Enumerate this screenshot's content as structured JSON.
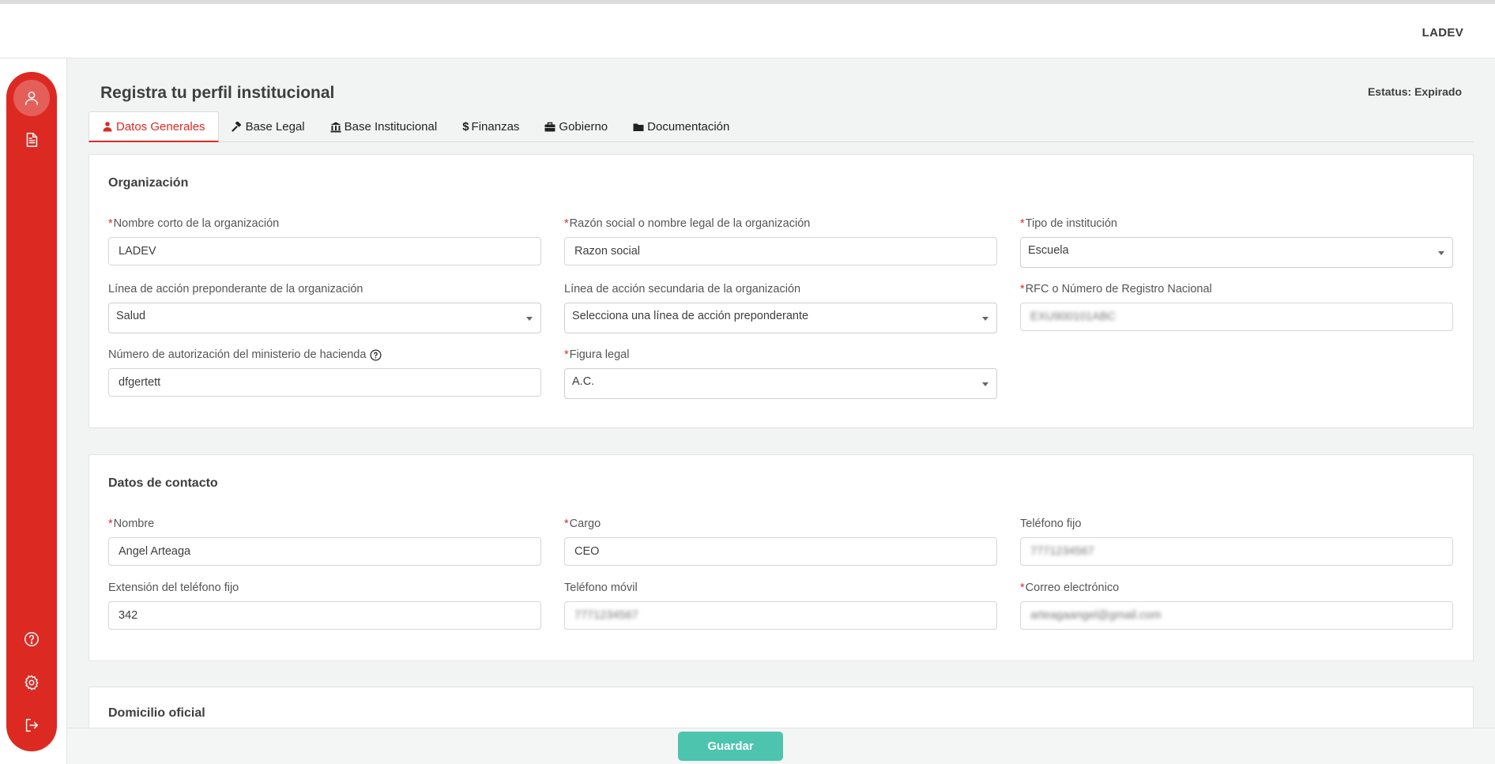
{
  "header": {
    "user": "LADEV"
  },
  "page": {
    "title": "Registra tu perfil institucional",
    "status": "Estatus: Expirado"
  },
  "tabs": [
    {
      "label": "Datos Generales",
      "icon": "user-icon"
    },
    {
      "label": "Base Legal",
      "icon": "gavel-icon"
    },
    {
      "label": "Base Institucional",
      "icon": "institution-icon"
    },
    {
      "label": "Finanzas",
      "icon": "dollar-icon",
      "glyph": "$"
    },
    {
      "label": "Gobierno",
      "icon": "briefcase-icon"
    },
    {
      "label": "Documentación",
      "icon": "folder-icon"
    }
  ],
  "organizacion": {
    "title": "Organización",
    "nombre_corto": {
      "label": "Nombre corto de la organización",
      "value": "LADEV"
    },
    "razon_social": {
      "label": "Razón social o nombre legal de la organización",
      "value": "Razon social"
    },
    "tipo_institucion": {
      "label": "Tipo de institución",
      "value": "Escuela"
    },
    "linea_preponderante": {
      "label": "Línea de acción preponderante de la organización",
      "value": "Salud"
    },
    "linea_secundaria": {
      "label": "Línea de acción secundaria de la organización",
      "value": "Selecciona una línea de acción preponderante"
    },
    "rfc": {
      "label": "RFC o Número de Registro Nacional",
      "value": "EXU900101ABC"
    },
    "autorizacion": {
      "label": "Número de autorización del ministerio de hacienda",
      "value": "dfgertett"
    },
    "figura_legal": {
      "label": "Figura legal",
      "value": "A.C."
    }
  },
  "contacto": {
    "title": "Datos de contacto",
    "nombre": {
      "label": "Nombre",
      "value": "Angel Arteaga"
    },
    "cargo": {
      "label": "Cargo",
      "value": "CEO"
    },
    "telefono_fijo": {
      "label": "Teléfono fijo",
      "value": "7771234567"
    },
    "extension": {
      "label": "Extensión del teléfono fijo",
      "value": "342"
    },
    "telefono_movil": {
      "label": "Teléfono móvil",
      "value": "7771234567"
    },
    "correo": {
      "label": "Correo electrónico",
      "value": "arteagaangel@gmail.com"
    }
  },
  "domicilio": {
    "title": "Domicilio oficial"
  },
  "footer": {
    "save_label": "Guardar"
  },
  "colors": {
    "accent": "#dc2a23",
    "save": "#4dc4ae"
  }
}
